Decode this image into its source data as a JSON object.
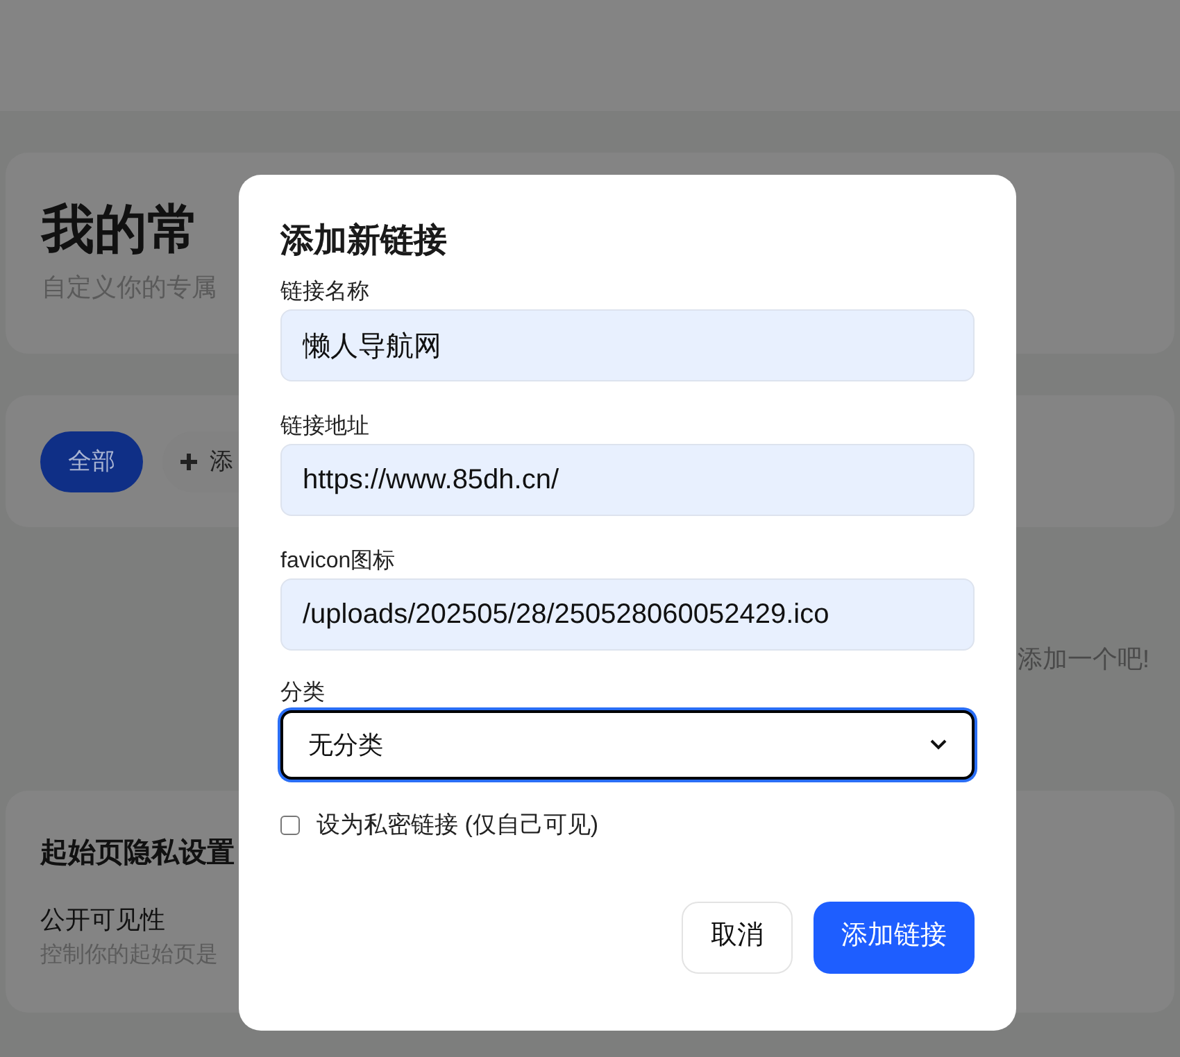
{
  "background": {
    "header_title": "我的常",
    "header_subtitle": "自定义你的专属",
    "filters": [
      {
        "label": "全部",
        "selected": true
      },
      {
        "label": "添",
        "selected": false
      }
    ],
    "empty_message": "添加一个吧!",
    "privacy": {
      "title": "起始页隐私设置",
      "setting_label": "公开可见性",
      "setting_hint": "控制你的起始页是"
    }
  },
  "dialog": {
    "title": "添加新链接",
    "fields": [
      {
        "kind": "input",
        "label": "链接名称",
        "value": "懒人导航网"
      },
      {
        "kind": "input",
        "label": "链接地址",
        "value": "https://www.85dh.cn/"
      },
      {
        "kind": "input",
        "label": "favicon图标",
        "value": "/uploads/202505/28/250528060052429.ico"
      },
      {
        "kind": "select",
        "label": "分类",
        "value": "无分类"
      }
    ],
    "private": {
      "label": "设为私密链接 (仅自己可见)",
      "checked": false
    },
    "buttons": [
      {
        "kind": "secondary",
        "label": "取消"
      },
      {
        "kind": "primary",
        "label": "添加链接"
      }
    ]
  }
}
